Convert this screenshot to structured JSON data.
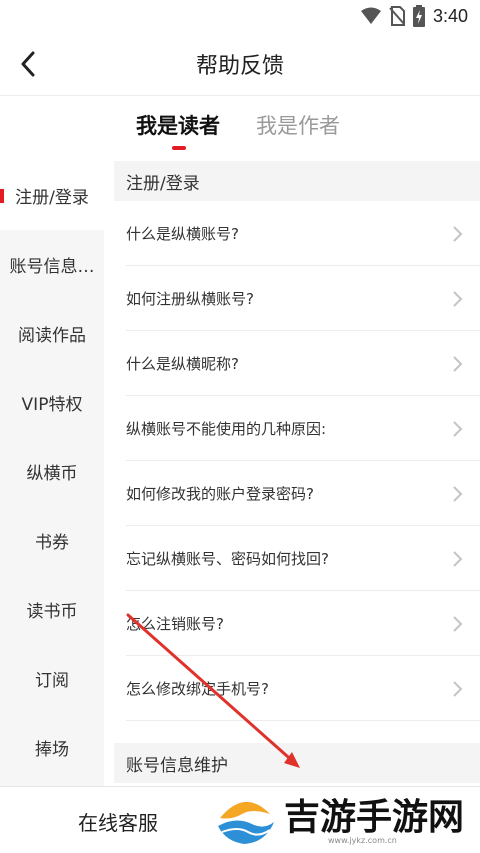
{
  "status_bar": {
    "time": "3:40"
  },
  "nav": {
    "title": "帮助反馈"
  },
  "tabs": [
    {
      "label": "我是读者",
      "active": true
    },
    {
      "label": "我是作者",
      "active": false
    }
  ],
  "sidebar": {
    "items": [
      {
        "label": "注册/登录",
        "active": true
      },
      {
        "label": "账号信息…",
        "active": false
      },
      {
        "label": "阅读作品",
        "active": false
      },
      {
        "label": "VIP特权",
        "active": false
      },
      {
        "label": "纵横币",
        "active": false
      },
      {
        "label": "书券",
        "active": false
      },
      {
        "label": "读书币",
        "active": false
      },
      {
        "label": "订阅",
        "active": false
      },
      {
        "label": "捧场",
        "active": false
      }
    ]
  },
  "content": {
    "sections": [
      {
        "title": "注册/登录",
        "questions": [
          "什么是纵横账号?",
          "如何注册纵横账号?",
          "什么是纵横昵称?",
          "纵横账号不能使用的几种原因:",
          "如何修改我的账户登录密码?",
          "忘记纵横账号、密码如何找回?",
          "怎么注销账号?",
          "怎么修改绑定手机号?"
        ]
      },
      {
        "title": "账号信息维护",
        "questions": []
      }
    ]
  },
  "bottom": {
    "service_label": "在线客服"
  },
  "watermark": {
    "text": "吉游手游网",
    "url": "www.jykz.com.cn"
  },
  "colors": {
    "accent": "#e31c23",
    "annotation_arrow": "#e0312a"
  }
}
